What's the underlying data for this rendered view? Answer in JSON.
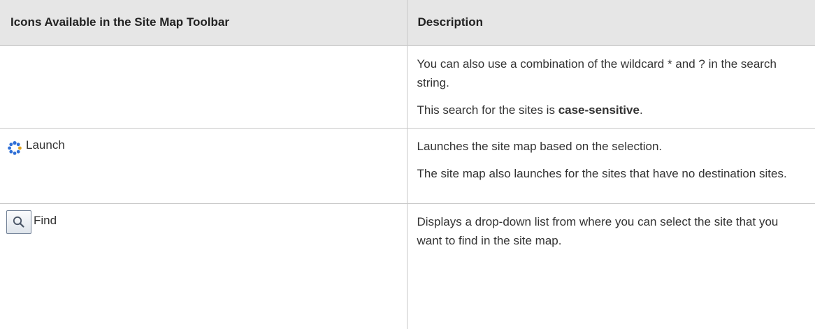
{
  "table": {
    "headers": [
      "Icons Available in the Site Map Toolbar",
      "Description"
    ],
    "row1": {
      "desc1": "You can also use a combination of the wildcard * and ? in the search string.",
      "desc2_prefix": "This search for the sites is ",
      "desc2_bold": "case-sensitive",
      "desc2_suffix": "."
    },
    "row2": {
      "icon": "launch-icon",
      "label": "Launch",
      "desc1": "Launches the site map based on the selection.",
      "desc2": "The site map also launches for the sites that have no destination sites."
    },
    "row3": {
      "icon": "search-icon",
      "label": "Find",
      "desc1": "Displays a drop-down list from where you can select the site that you want to find in the site map."
    }
  }
}
